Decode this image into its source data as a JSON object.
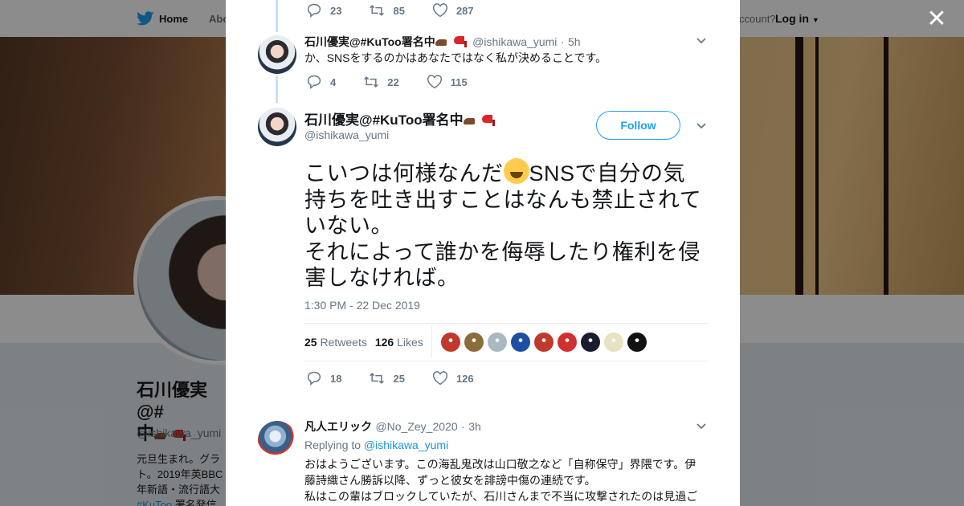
{
  "nav": {
    "home": "Home",
    "about": "Abo",
    "account": "ccount?",
    "login": "Log in"
  },
  "profile": {
    "name_line1": "石川優実@#",
    "name_line2": "中",
    "handle": "@ishikawa_yumi",
    "bio_line1": "元旦生まれ。グラ",
    "bio_line2": "ト。2019年英BBC",
    "bio_line3": "年新語・流行語大",
    "bio_line4_link": "#KuToo",
    "bio_line4_rest": " 署名発信"
  },
  "tweets": [
    {
      "actions": {
        "replies": "23",
        "retweets": "85",
        "likes": "287"
      }
    },
    {
      "name": "石川優実@#KuToo署名中",
      "handle": "@ishikawa_yumi",
      "sep": "·",
      "time": "5h",
      "text": "か、SNSをするのかはあなたではなく私が決めることです。",
      "actions": {
        "replies": "4",
        "retweets": "22",
        "likes": "115"
      }
    }
  ],
  "main_tweet": {
    "name": "石川優実@#KuToo署名中",
    "handle": "@ishikawa_yumi",
    "follow": "Follow",
    "text_part1": "こいつは何様なんだ",
    "text_part2": "SNSで自分の気持ちを吐き出すことはなんも禁止されていない。",
    "text_part3": "それによって誰かを侮辱したり権利を侵害しなければ。",
    "timestamp": "1:30 PM - 22 Dec 2019",
    "retweets_count": "25",
    "retweets_label": "Retweets",
    "likes_count": "126",
    "likes_label": "Likes",
    "likers": [
      "#c0392b",
      "#8a6d3b",
      "#aab8c2",
      "#1f4fa3",
      "#c0392b",
      "#d22f2f",
      "#1b1b2f",
      "#e8e2c2",
      "#111111"
    ],
    "actions": {
      "replies": "18",
      "retweets": "25",
      "likes": "126"
    }
  },
  "reply": {
    "name": "凡人エリック",
    "handle": "@No_Zey_2020",
    "sep": "·",
    "time": "3h",
    "replying_label": "Replying to",
    "replying_handle": "@ishikawa_yumi",
    "text_line1": "おはようございます。この海乱鬼改は山口敬之など「自称保守」界隈です。伊",
    "text_line2": "藤詩織さん勝訴以降、ずっと彼女を誹謗中傷の連続です。",
    "text_line3": "私はこの輩はブロックしていたが、石川さんまで不当に攻撃されたのは見過ご"
  },
  "colors": {
    "accent": "#1da1f2",
    "secondary_text": "#657786",
    "thread_line": "#c4e3f3"
  }
}
